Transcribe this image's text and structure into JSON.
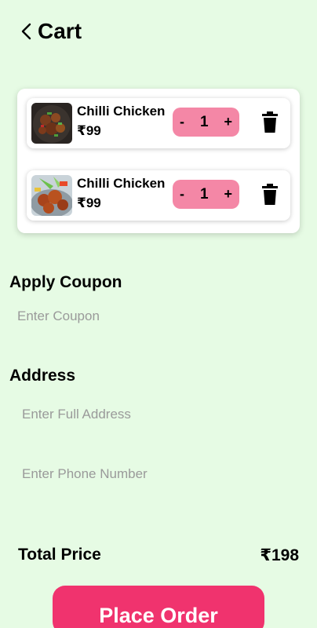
{
  "header": {
    "title": "Cart",
    "back_icon": "chevron-left-icon"
  },
  "cart": {
    "items": [
      {
        "name": "Chilli Chicken",
        "price": "₹99",
        "quantity": "1",
        "decrement": "-",
        "increment": "+",
        "image": "chilli-chicken-dark-plate"
      },
      {
        "name": "Chilli Chicken",
        "price": "₹99",
        "quantity": "1",
        "decrement": "-",
        "increment": "+",
        "image": "chilli-chicken-light-plate"
      }
    ]
  },
  "coupon": {
    "label": "Apply Coupon",
    "placeholder": "Enter Coupon"
  },
  "address": {
    "label": "Address",
    "address_placeholder": "Enter Full Address",
    "phone_placeholder": "Enter Phone Number"
  },
  "total": {
    "label": "Total Price",
    "value": "₹198"
  },
  "actions": {
    "place_order": "Place Order"
  },
  "colors": {
    "background": "#e6fbe4",
    "stepper": "#f487a6",
    "button": "#f0336e"
  }
}
